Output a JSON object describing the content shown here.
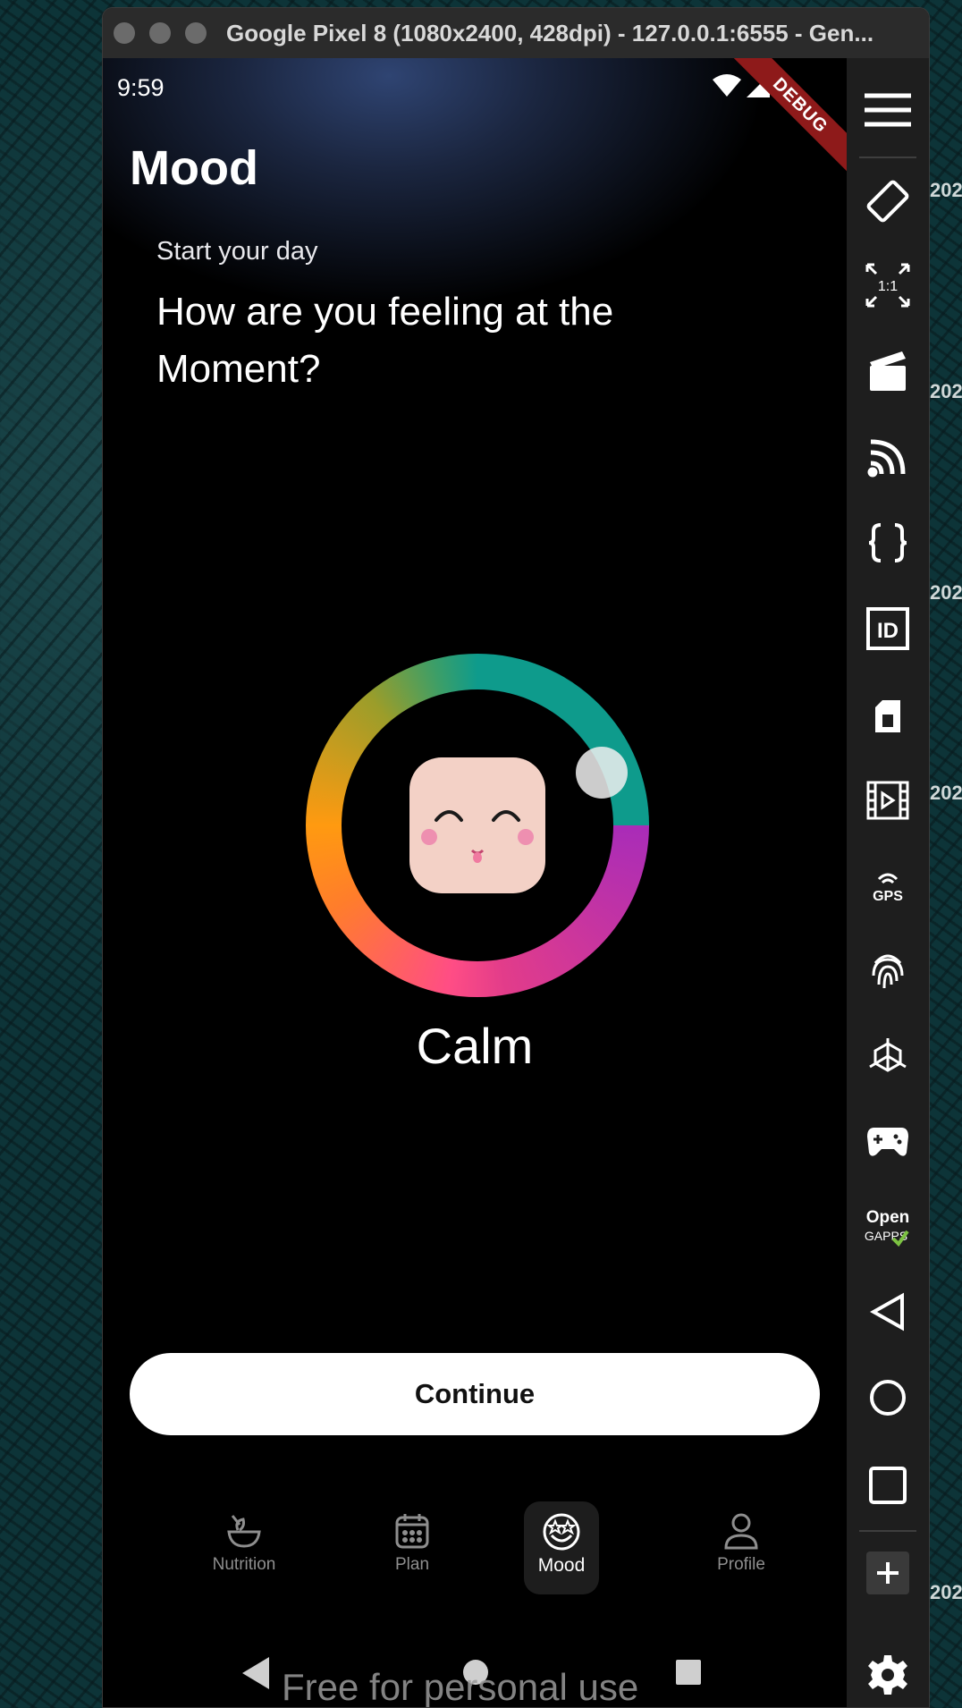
{
  "background": {
    "year_fragments": [
      "202",
      "202",
      "202",
      "202",
      "202"
    ]
  },
  "window": {
    "title": "Google Pixel 8 (1080x2400, 428dpi) - 127.0.0.1:6555 - Gen..."
  },
  "status_bar": {
    "time": "9:59",
    "debug_banner": "DEBUG"
  },
  "app": {
    "title": "Mood",
    "subtitle": "Start your day",
    "question": "How are you feeling at the Moment?",
    "selected_mood": "Calm",
    "continue_label": "Continue",
    "colors": {
      "ring_teal": "#0e9b8c",
      "ring_purple": "#a92cb8",
      "ring_pink": "#ff4d85",
      "ring_orange": "#ff9a10",
      "face": "#f3d1c6"
    }
  },
  "bottom_nav": {
    "items": [
      {
        "label": "Nutrition",
        "icon": "bowl-icon"
      },
      {
        "label": "Plan",
        "icon": "calendar-icon"
      },
      {
        "label": "Mood",
        "icon": "smiley-icon",
        "active": true
      },
      {
        "label": "Profile",
        "icon": "person-icon"
      }
    ]
  },
  "watermark": "Free for personal use",
  "toolbar": {
    "items": [
      "menu-icon",
      "rotate-icon",
      "zoom-1-1-icon",
      "clapper-icon",
      "cast-icon",
      "braces-icon",
      "id-icon",
      "sim-icon",
      "video-icon",
      "gps-icon",
      "fingerprint-icon",
      "sensor-icon",
      "gamepad-icon",
      "opengapps-icon",
      "back-icon",
      "home-icon",
      "overview-icon",
      "plus-icon",
      "settings-icon"
    ],
    "zoom_label": "1:1",
    "id_label": "ID",
    "gps_label": "GPS",
    "opengapps_line1": "Open",
    "opengapps_line2": "GAPPS"
  }
}
